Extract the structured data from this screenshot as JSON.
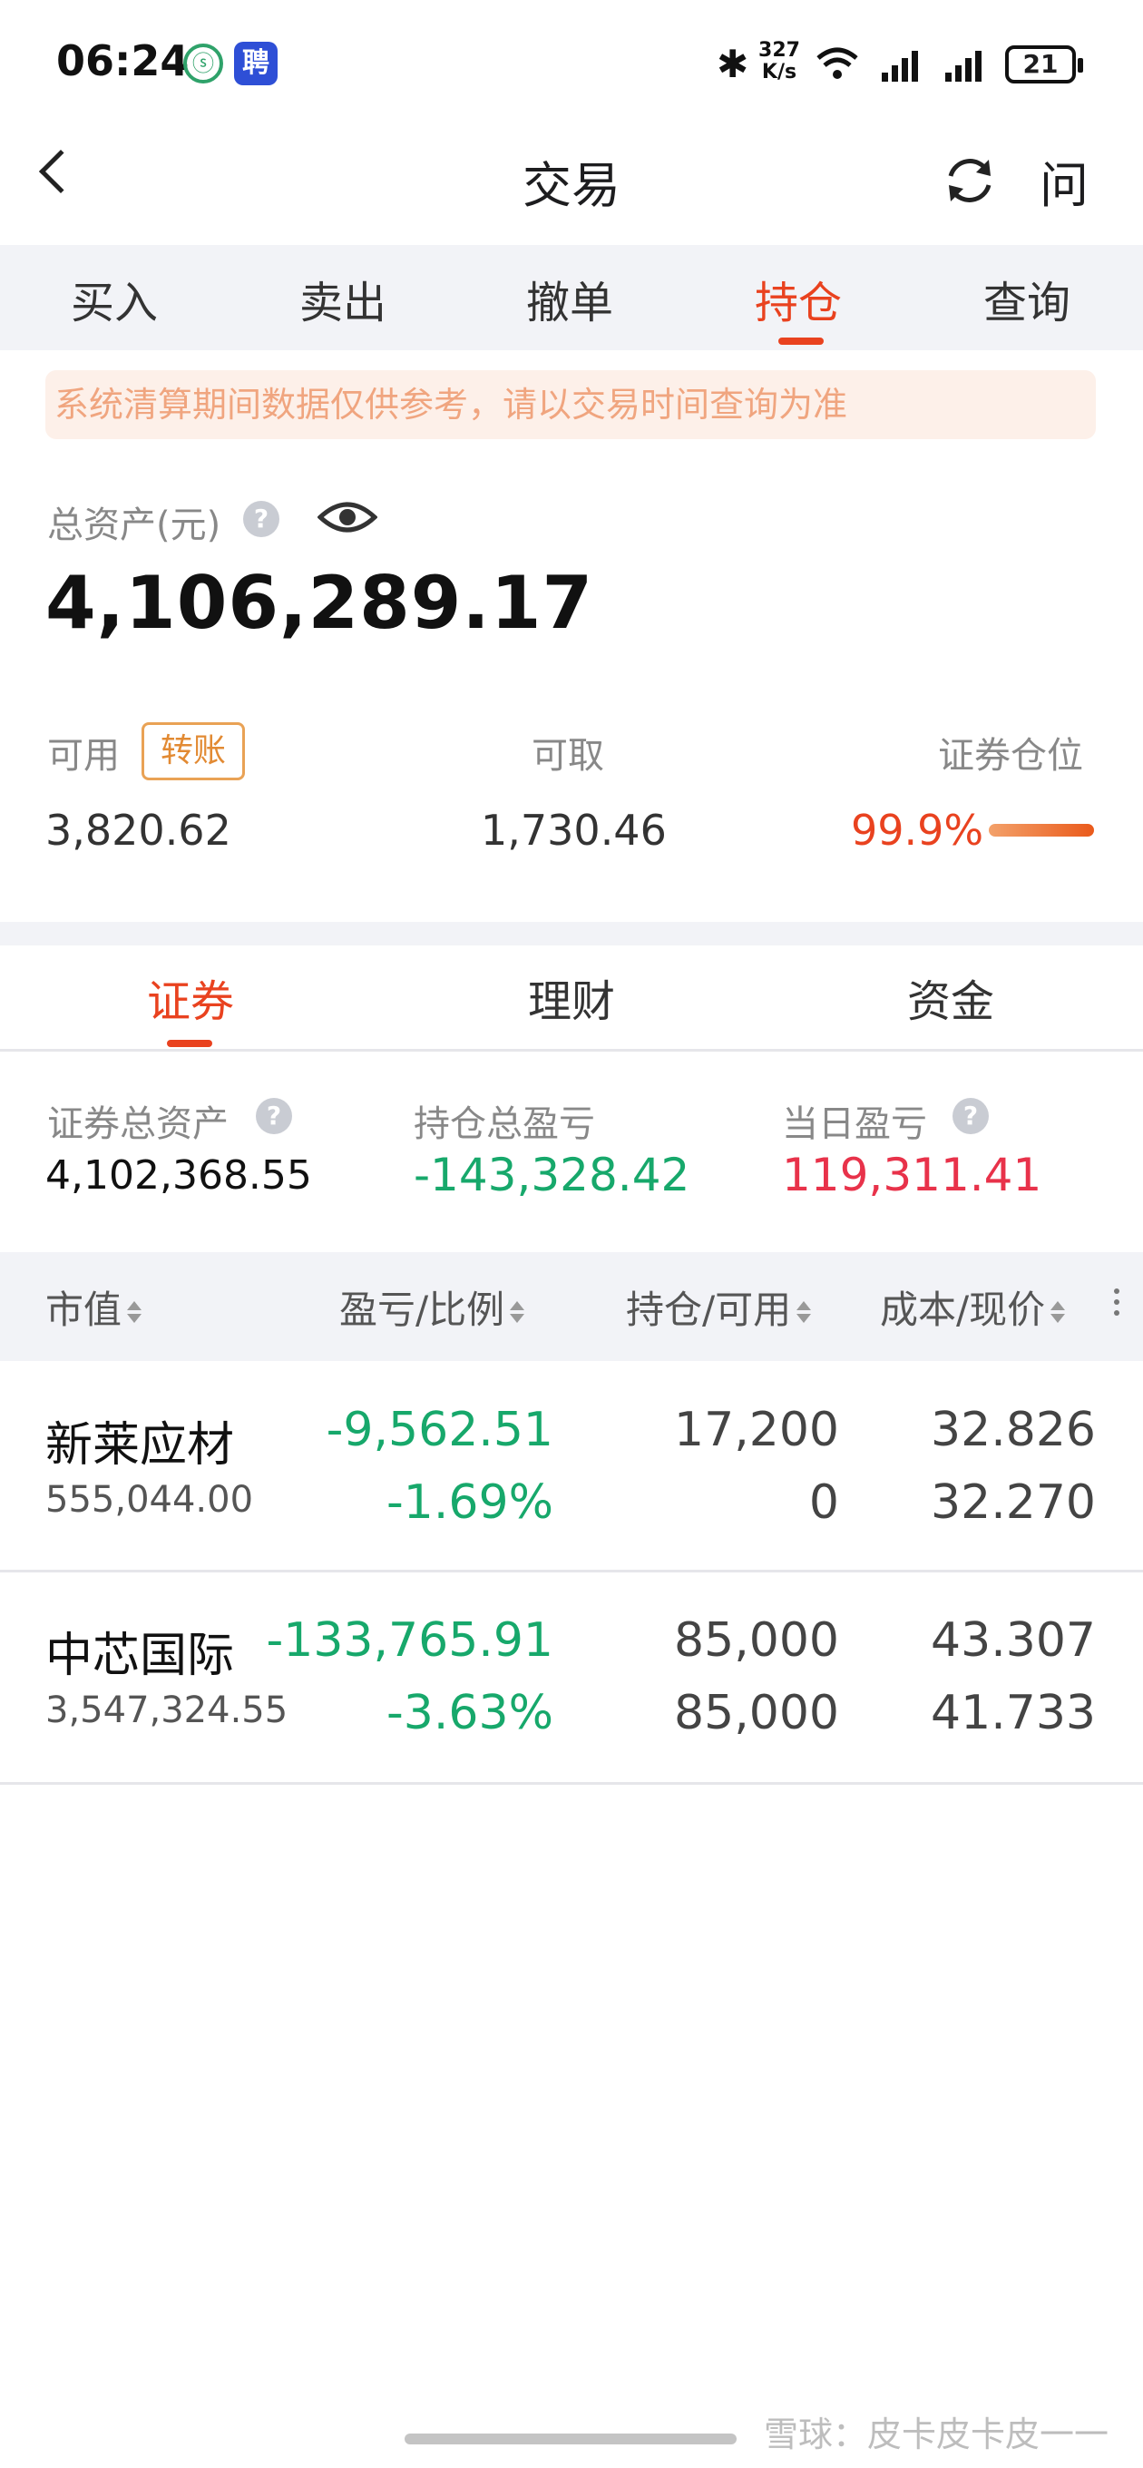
{
  "status_bar": {
    "time": "06:24",
    "app_icon_1": "ⓢ",
    "app_icon_2": "聘",
    "speed": "327 K/s",
    "battery": "21"
  },
  "header": {
    "title": "交易",
    "help_label": "问"
  },
  "trade_tabs": [
    "买入",
    "卖出",
    "撤单",
    "持仓",
    "查询"
  ],
  "notice": "系统清算期间数据仅供参考，请以交易时间查询为准",
  "assets": {
    "total_label": "总资产(元)",
    "total_value": "4,106,289.17",
    "available_label": "可用",
    "transfer_label": "转账",
    "available_value": "3,820.62",
    "withdrawable_label": "可取",
    "withdrawable_value": "1,730.46",
    "position_label": "证券仓位",
    "position_value": "99.9%",
    "position_ratio": 0.999
  },
  "sub_tabs": [
    "证券",
    "理财",
    "资金"
  ],
  "summary": {
    "securities_assets_label": "证券总资产",
    "securities_assets_value": "4,102,368.55",
    "holding_pl_label": "持仓总盈亏",
    "holding_pl_value": "-143,328.42",
    "daily_pl_label": "当日盈亏",
    "daily_pl_value": "119,311.41"
  },
  "table": {
    "headers": [
      "市值",
      "盈亏/比例",
      "持仓/可用",
      "成本/现价"
    ],
    "rows": [
      {
        "name": "新莱应材",
        "market_value": "555,044.00",
        "pl_amount": "-9,562.51",
        "pl_percent": "-1.69%",
        "holding": "17,200",
        "available": "0",
        "cost": "32.826",
        "price": "32.270"
      },
      {
        "name": "中芯国际",
        "market_value": "3,547,324.55",
        "pl_amount": "-133,765.91",
        "pl_percent": "-3.63%",
        "holding": "85,000",
        "available": "85,000",
        "cost": "43.307",
        "price": "41.733"
      }
    ]
  },
  "watermark": "雪球：皮卡皮卡皮一一",
  "colors": {
    "accent": "#e9421f",
    "gain": "#e8324a",
    "loss": "#17a86b"
  }
}
